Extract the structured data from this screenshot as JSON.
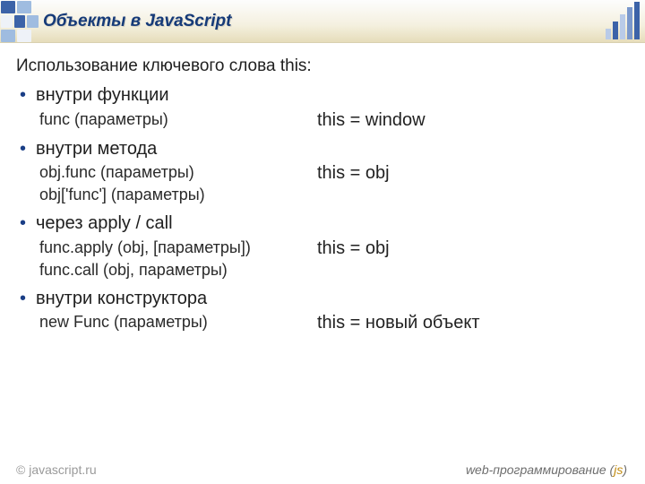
{
  "title": "Объекты в JavaScript",
  "intro": "Использование ключевого слова this:",
  "sections": [
    {
      "heading": "внутри функции",
      "left": [
        "func (параметры)"
      ],
      "right": "this = window"
    },
    {
      "heading": "внутри метода",
      "left": [
        "obj.func (параметры)",
        "obj['func'] (параметры)"
      ],
      "right": "this = obj"
    },
    {
      "heading": "через apply / call",
      "left": [
        "func.apply (obj, [параметры])",
        "func.call (obj, параметры)"
      ],
      "right": "this = obj"
    },
    {
      "heading": "внутри конструктора",
      "left": [
        "new Func (параметры)"
      ],
      "right": "this = новый объект"
    }
  ],
  "footer": {
    "left": "© javascript.ru",
    "right_prefix": "web-программирование (",
    "right_js": "js",
    "right_suffix": ")"
  }
}
